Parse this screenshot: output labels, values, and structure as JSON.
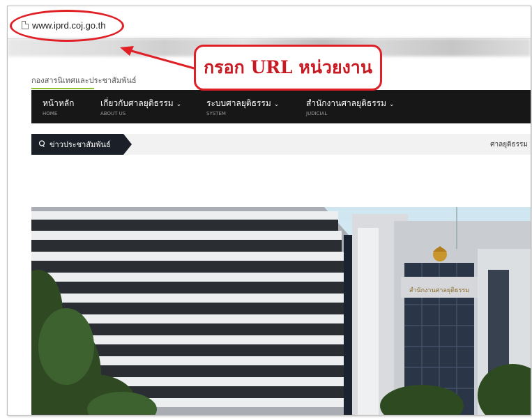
{
  "browser": {
    "url": "www.iprd.coj.go.th"
  },
  "site": {
    "title": "กองสารนิเทศและประชาสัมพันธ์",
    "nav": [
      {
        "main": "หน้าหลัก",
        "sub": "HOME",
        "caret": ""
      },
      {
        "main": "เกี่ยวกับศาลยุติธรรม",
        "sub": "ABOUT US",
        "caret": "⌄"
      },
      {
        "main": "ระบบศาลยุติธรรม",
        "sub": "SYSTEM",
        "caret": "⌄"
      },
      {
        "main": "สำนักงานศาลยุติธรรม",
        "sub": "JUDICIAL",
        "caret": "⌄"
      }
    ],
    "news_label": "ข่าวประชาสัมพันธ์",
    "news_right": "ศาลยุติธรรม",
    "building_sign": "สำนักงานศาลยุติธรรม"
  },
  "annotation": {
    "callout": "กรอก URL หน่วยงาน"
  },
  "colors": {
    "annotation_red": "#e01f26",
    "nav_bg": "#171717",
    "accent_green": "#8bbf2b"
  }
}
